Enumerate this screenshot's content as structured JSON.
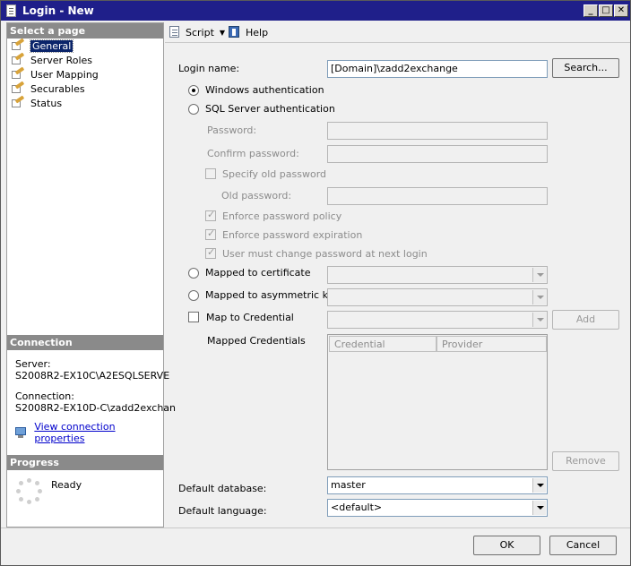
{
  "window": {
    "title": "Login - New",
    "controls": {
      "minimize": "_",
      "maximize": "□",
      "close": "✕"
    }
  },
  "select_page": {
    "header": "Select a page",
    "items": [
      {
        "label": "General",
        "icon": "settings-page-icon",
        "selected": true
      },
      {
        "label": "Server Roles",
        "icon": "settings-page-icon",
        "selected": false
      },
      {
        "label": "User Mapping",
        "icon": "settings-page-icon",
        "selected": false
      },
      {
        "label": "Securables",
        "icon": "settings-page-icon",
        "selected": false
      },
      {
        "label": "Status",
        "icon": "settings-page-icon",
        "selected": false
      }
    ]
  },
  "connection": {
    "header": "Connection",
    "server_label": "Server:",
    "server_value": "S2008R2-EX10C\\A2ESQLSERVE",
    "connection_label": "Connection:",
    "connection_value": "S2008R2-EX10D-C\\zadd2exchan",
    "link": "View connection properties"
  },
  "progress": {
    "header": "Progress",
    "status": "Ready"
  },
  "toolbar": {
    "script": "Script",
    "help": "Help"
  },
  "form": {
    "login_name_label": "Login name:",
    "login_name_value": "[Domain]\\zadd2exchange",
    "search_button": "Search...",
    "windows_auth": "Windows authentication",
    "sql_auth": "SQL Server authentication",
    "password_label": "Password:",
    "confirm_password_label": "Confirm password:",
    "specify_old_password": "Specify old password",
    "old_password_label": "Old password:",
    "enforce_policy": "Enforce password policy",
    "enforce_expiration": "Enforce password expiration",
    "must_change": "User must change password at next login",
    "mapped_cert": "Mapped to certificate",
    "mapped_asym": "Mapped to asymmetric key",
    "map_credential": "Map to Credential",
    "add_button": "Add",
    "mapped_credentials_label": "Mapped Credentials",
    "grid_columns": [
      "Credential",
      "Provider"
    ],
    "remove_button": "Remove",
    "default_db_label": "Default database:",
    "default_db_value": "master",
    "default_lang_label": "Default language:",
    "default_lang_value": "<default>"
  },
  "footer": {
    "ok": "OK",
    "cancel": "Cancel"
  },
  "colors": {
    "titlebar": "#1f1f8a",
    "selection": "#0a246a",
    "pane_header": "#8a8a8a",
    "link": "#0000cc"
  }
}
